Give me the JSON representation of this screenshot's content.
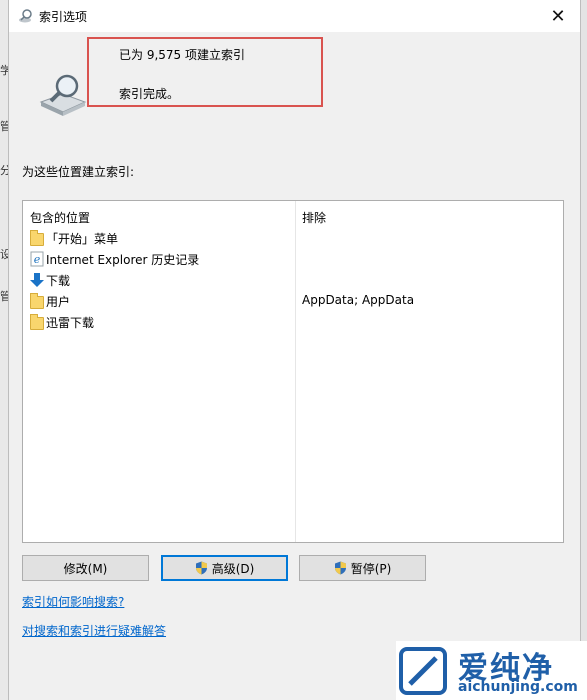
{
  "window": {
    "title": "索引选项"
  },
  "status": {
    "indexed_count": "已为 9,575 项建立索引",
    "message": "索引完成。"
  },
  "section_label": "为这些位置建立索引:",
  "table": {
    "headers": {
      "included": "包含的位置",
      "excluded": "排除"
    },
    "rows": [
      {
        "name": "「开始」菜单",
        "icon": "folder-icon",
        "excluded": ""
      },
      {
        "name": "Internet Explorer 历史记录",
        "icon": "ie-icon",
        "excluded": ""
      },
      {
        "name": "下载",
        "icon": "download-arrow-icon",
        "excluded": ""
      },
      {
        "name": "用户",
        "icon": "folder-icon",
        "excluded": "AppData; AppData"
      },
      {
        "name": "迅雷下载",
        "icon": "folder-icon",
        "excluded": ""
      }
    ]
  },
  "buttons": {
    "modify": "修改(M)",
    "advanced": "高级(D)",
    "pause": "暂停(P)"
  },
  "links": {
    "how_indexing_affects": "索引如何影响搜索?",
    "troubleshoot": "对搜索和索引进行疑难解答"
  },
  "background_text": [
    "学",
    "管",
    "分",
    "设",
    "管"
  ],
  "watermark": {
    "brand": "爱纯净",
    "url": "aichunjing.com"
  },
  "colors": {
    "highlight_border": "#d9534f",
    "link": "#0066cc",
    "focus": "#0078d7"
  }
}
